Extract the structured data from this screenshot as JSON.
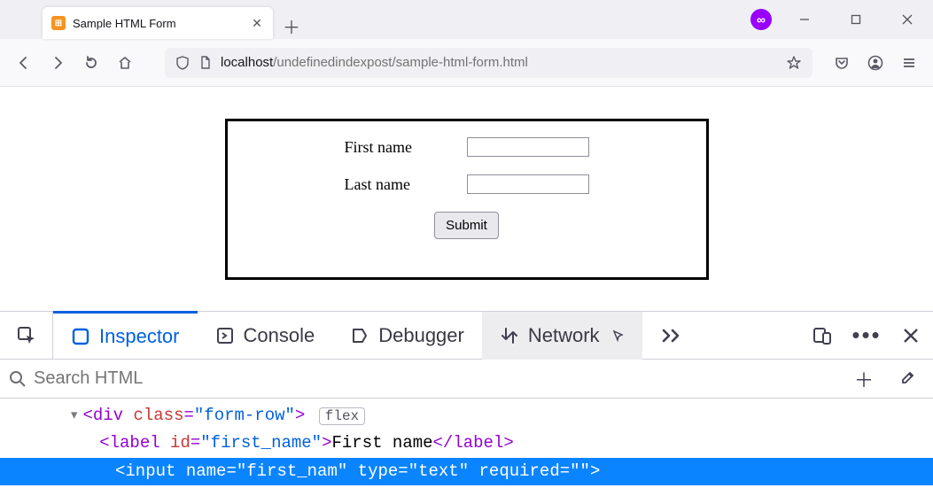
{
  "tab": {
    "title": "Sample HTML Form"
  },
  "url": {
    "host": "localhost",
    "path": "/undefinedindexpost/sample-html-form.html"
  },
  "form": {
    "first_label": "First name",
    "last_label": "Last name",
    "first_value": "",
    "last_value": "",
    "submit_label": "Submit"
  },
  "devtools": {
    "tabs": {
      "inspector": "Inspector",
      "console": "Console",
      "debugger": "Debugger",
      "network": "Network"
    },
    "search_placeholder": "Search HTML",
    "dom": {
      "line1_open": "<div ",
      "line1_attr": "class",
      "line1_val": "\"form-row\"",
      "line1_close": ">",
      "line1_badge": "flex",
      "line2_open": "<label ",
      "line2_attr": "id",
      "line2_val": "\"first_name\"",
      "line2_text": "First name",
      "line2_close": "</label>",
      "line3_open": "<input ",
      "line3_a1": "name",
      "line3_v1": "\"first_nam\"",
      "line3_a2": "type",
      "line3_v2": "\"text\"",
      "line3_a3": "required",
      "line3_v3": "\"\"",
      "line3_close": ">"
    }
  }
}
